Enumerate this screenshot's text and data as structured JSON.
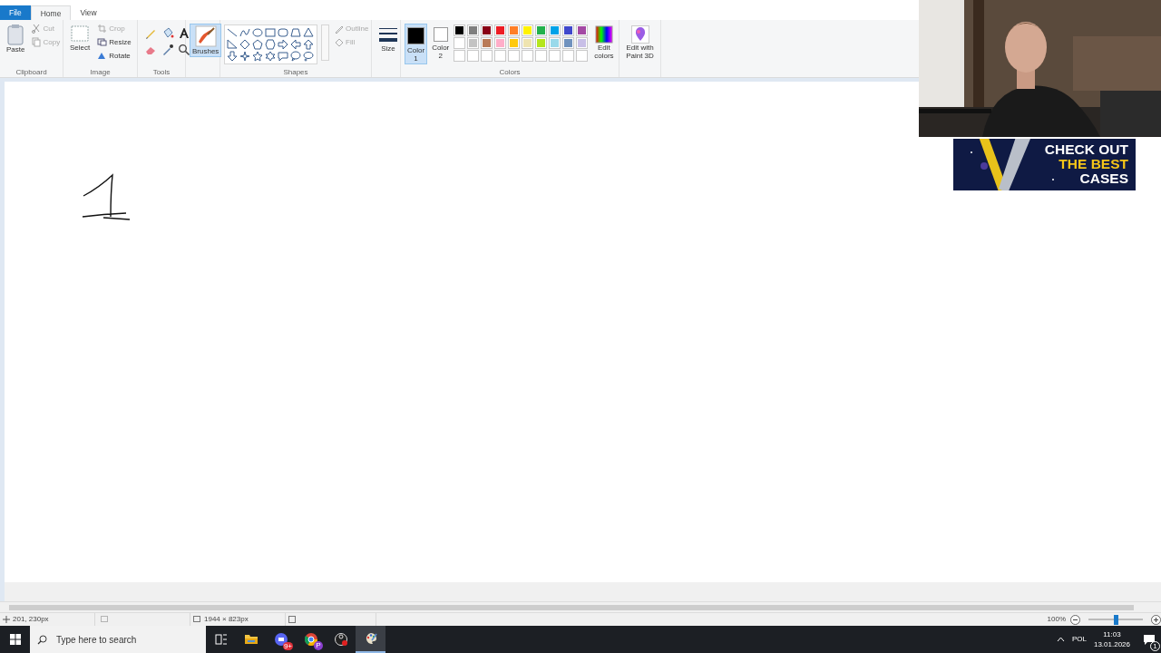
{
  "tabs": [
    {
      "label": "File",
      "kind": "file",
      "selected": false
    },
    {
      "label": "Home",
      "kind": "tab",
      "selected": true
    },
    {
      "label": "View",
      "kind": "tab",
      "selected": false
    }
  ],
  "clipboard": {
    "group_label": "Clipboard",
    "paste": {
      "label": "Paste",
      "disabled": false
    },
    "cut": {
      "label": "Cut",
      "disabled": true
    },
    "copy": {
      "label": "Copy",
      "disabled": true
    }
  },
  "image": {
    "group_label": "Image",
    "select": {
      "label": "Select",
      "disabled": false
    },
    "crop": {
      "label": "Crop",
      "disabled": true
    },
    "resize": {
      "label": "Resize",
      "disabled": false
    },
    "rotate": {
      "label": "Rotate",
      "disabled": false
    }
  },
  "tools": {
    "group_label": "Tools"
  },
  "brushes": {
    "label": "Brushes",
    "selected": true
  },
  "shapes": {
    "group_label": "Shapes",
    "outline": {
      "label": "Outline",
      "disabled": true
    },
    "fill": {
      "label": "Fill",
      "disabled": true
    }
  },
  "size": {
    "label": "Size"
  },
  "colors": {
    "group_label": "Colors",
    "color1": {
      "label": "Color 1",
      "color": "#000000",
      "selected": true
    },
    "color2": {
      "label": "Color 2",
      "color": "#ffffff",
      "selected": false
    },
    "swatches": [
      {
        "kind": "color",
        "color": "#000000"
      },
      {
        "kind": "color",
        "color": "#7f7f7f"
      },
      {
        "kind": "color",
        "color": "#880015"
      },
      {
        "kind": "color",
        "color": "#ed1c24"
      },
      {
        "kind": "color",
        "color": "#ff7f27"
      },
      {
        "kind": "color",
        "color": "#fff200"
      },
      {
        "kind": "color",
        "color": "#22b14c"
      },
      {
        "kind": "color",
        "color": "#00a2e8"
      },
      {
        "kind": "color",
        "color": "#3f48cc"
      },
      {
        "kind": "color",
        "color": "#a349a4"
      },
      {
        "kind": "color",
        "color": "#ffffff"
      },
      {
        "kind": "color",
        "color": "#c3c3c3"
      },
      {
        "kind": "color",
        "color": "#b97a57"
      },
      {
        "kind": "color",
        "color": "#ffaec9"
      },
      {
        "kind": "color",
        "color": "#ffc90e"
      },
      {
        "kind": "color",
        "color": "#efe4b0"
      },
      {
        "kind": "color",
        "color": "#b5e61d"
      },
      {
        "kind": "color",
        "color": "#99d9ea"
      },
      {
        "kind": "color",
        "color": "#7092be"
      },
      {
        "kind": "color",
        "color": "#c8bfe7"
      },
      {
        "kind": "empty"
      },
      {
        "kind": "empty"
      },
      {
        "kind": "empty"
      },
      {
        "kind": "empty"
      },
      {
        "kind": "empty"
      },
      {
        "kind": "empty"
      },
      {
        "kind": "empty"
      },
      {
        "kind": "empty"
      },
      {
        "kind": "empty"
      },
      {
        "kind": "empty"
      }
    ],
    "edit_colors": "Edit colors"
  },
  "paint3d": {
    "label": "Edit with Paint 3D"
  },
  "status_bar": {
    "cursor_position": "201, 230px",
    "canvas_size": "1944 × 823px",
    "zoom": "100%",
    "zoom_slider": {
      "level": 0.5
    }
  },
  "taskbar": {
    "search_placeholder": "Type here to search",
    "apps": [
      {
        "kind": "taskview"
      },
      {
        "kind": "folder"
      },
      {
        "kind": "chat",
        "badge": "9+"
      },
      {
        "kind": "browser",
        "badge": "P"
      },
      {
        "kind": "recorder"
      },
      {
        "kind": "paint",
        "selected": true
      }
    ],
    "language": "POL",
    "time": "11:03",
    "date": "13.01.2026",
    "notification_count": "1"
  },
  "overlays": {
    "banner": {
      "lines": [
        {
          "text": "CHECK OUT",
          "color": "#ffffff"
        },
        {
          "text": "THE BEST",
          "color": "#f5c518"
        },
        {
          "text": "CASES",
          "color": "#ffffff"
        }
      ]
    }
  }
}
